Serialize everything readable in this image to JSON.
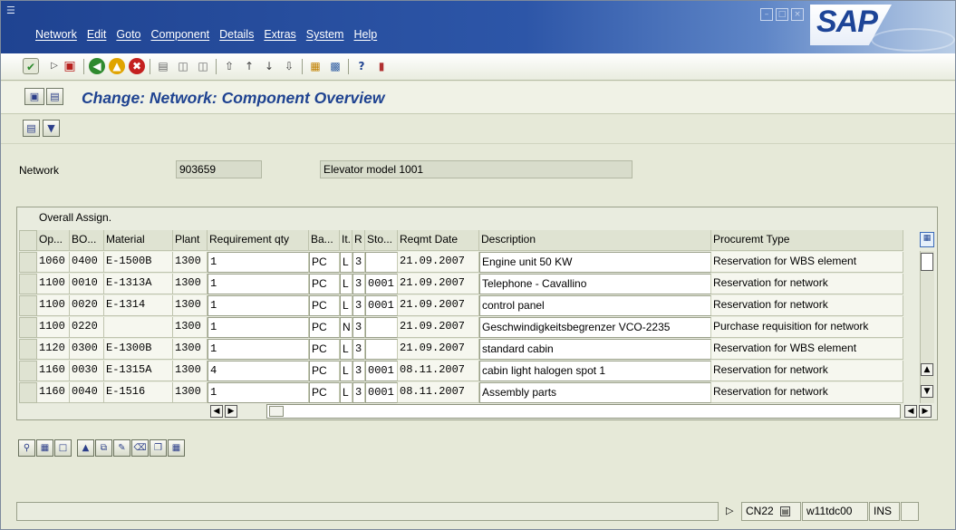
{
  "window": {
    "menu": [
      "Network",
      "Edit",
      "Goto",
      "Component",
      "Details",
      "Extras",
      "System",
      "Help"
    ],
    "logo_text": "SAP"
  },
  "header": {
    "title": "Change: Network: Component Overview"
  },
  "network": {
    "label": "Network",
    "number": "903659",
    "description": "Elevator model 1001"
  },
  "table": {
    "title": "Overall Assign.",
    "columns": [
      "Op...",
      "BO...",
      "Material",
      "Plant",
      "Requirement qty",
      "Ba...",
      "It.",
      "R",
      "Sto...",
      "Reqmt Date",
      "Description",
      "Procuremt Type"
    ],
    "rows": [
      {
        "op": "1060",
        "bo": "0400",
        "material": "E-1500B",
        "plant": "1300",
        "qty": "1",
        "base": "PC",
        "item": "L",
        "r": "3",
        "sto": "",
        "date": "21.09.2007",
        "desc": "Engine unit 50 KW",
        "proc": "Reservation for WBS element"
      },
      {
        "op": "1100",
        "bo": "0010",
        "material": "E-1313A",
        "plant": "1300",
        "qty": "1",
        "base": "PC",
        "item": "L",
        "r": "3",
        "sto": "0001",
        "date": "21.09.2007",
        "desc": "Telephone - Cavallino",
        "proc": "Reservation for network"
      },
      {
        "op": "1100",
        "bo": "0020",
        "material": "E-1314",
        "plant": "1300",
        "qty": "1",
        "base": "PC",
        "item": "L",
        "r": "3",
        "sto": "0001",
        "date": "21.09.2007",
        "desc": "control panel",
        "proc": "Reservation for network"
      },
      {
        "op": "1100",
        "bo": "0220",
        "material": "",
        "plant": "1300",
        "qty": "1",
        "base": "PC",
        "item": "N",
        "r": "3",
        "sto": "",
        "date": "21.09.2007",
        "desc": "Geschwindigkeitsbegrenzer VCO-2235",
        "proc": "Purchase requisition for network"
      },
      {
        "op": "1120",
        "bo": "0300",
        "material": "E-1300B",
        "plant": "1300",
        "qty": "1",
        "base": "PC",
        "item": "L",
        "r": "3",
        "sto": "",
        "date": "21.09.2007",
        "desc": "standard cabin",
        "proc": "Reservation for WBS element"
      },
      {
        "op": "1160",
        "bo": "0030",
        "material": "E-1315A",
        "plant": "1300",
        "qty": "4",
        "base": "PC",
        "item": "L",
        "r": "3",
        "sto": "0001",
        "date": "08.11.2007",
        "desc": "cabin light halogen spot 1",
        "proc": "Reservation for network"
      },
      {
        "op": "1160",
        "bo": "0040",
        "material": "E-1516",
        "plant": "1300",
        "qty": "1",
        "base": "PC",
        "item": "L",
        "r": "3",
        "sto": "0001",
        "date": "08.11.2007",
        "desc": "Assembly parts",
        "proc": "Reservation for network"
      }
    ]
  },
  "status": {
    "transaction": "CN22",
    "server": "w11tdc00",
    "mode": "INS"
  }
}
